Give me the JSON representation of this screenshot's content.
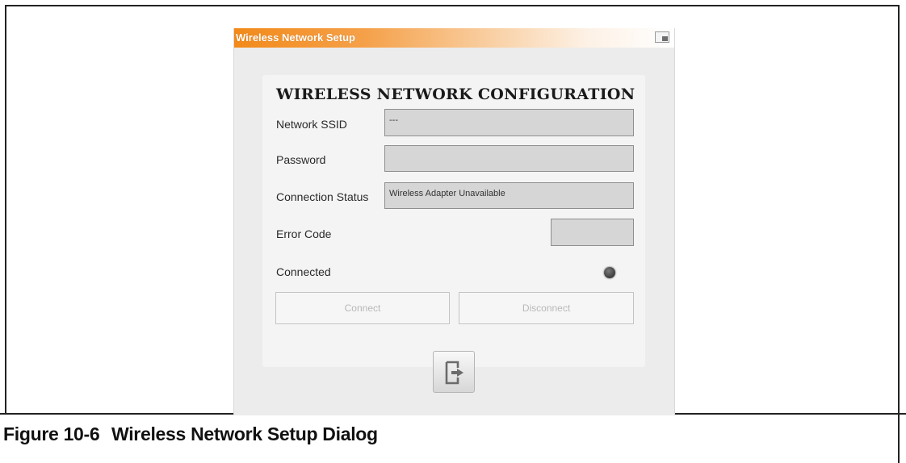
{
  "dialog": {
    "title": "Wireless Network Setup",
    "heading": "WIRELESS NETWORK CONFIGURATION",
    "fields": {
      "ssid_label": "Network SSID",
      "ssid_value": "---",
      "password_label": "Password",
      "password_value": "",
      "status_label": "Connection Status",
      "status_value": "Wireless Adapter Unavailable",
      "error_label": "Error Code",
      "error_value": "",
      "connected_label": "Connected"
    },
    "buttons": {
      "connect": "Connect",
      "disconnect": "Disconnect"
    },
    "icons": {
      "window": "window-icon",
      "exit": "exit-icon",
      "led": "connection-indicator-icon"
    }
  },
  "caption": {
    "number": "Figure 10-6",
    "title": "Wireless Network Setup Dialog"
  }
}
